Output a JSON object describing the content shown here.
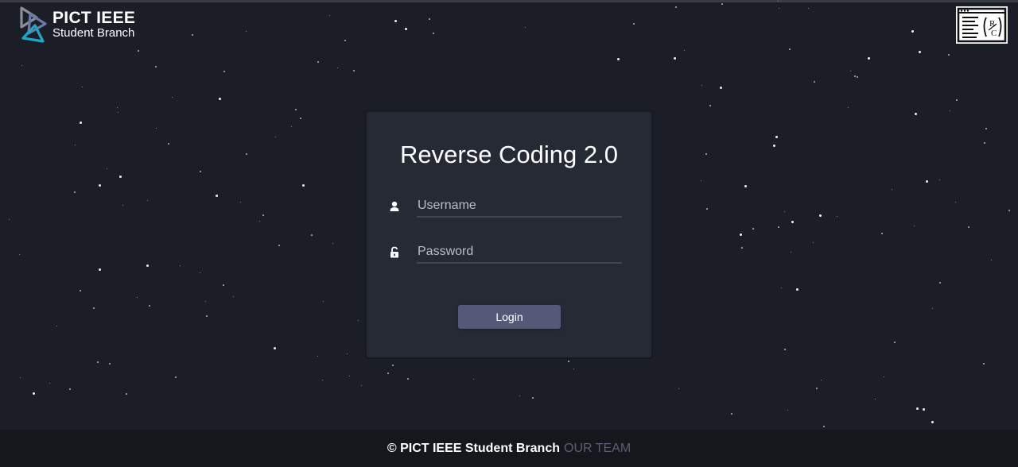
{
  "brand": {
    "logo_title": "PICT IEEE",
    "logo_subtitle": "Student Branch",
    "logo_icon": "triangle-logo-icon",
    "right_badge_icon": "rc-code-badge-icon"
  },
  "login_card": {
    "title": "Reverse Coding 2.0",
    "username": {
      "placeholder": "Username",
      "value": "",
      "icon": "user-icon"
    },
    "password": {
      "placeholder": "Password",
      "value": "",
      "icon": "unlock-icon"
    },
    "login_label": "Login"
  },
  "footer": {
    "copyright": "© PICT IEEE Student Branch",
    "team_link": "OUR TEAM"
  },
  "colors": {
    "background": "#1b1e27",
    "card": "#252a35",
    "button": "#545978",
    "footer": "#15171c",
    "footer_link": "#595f75"
  }
}
